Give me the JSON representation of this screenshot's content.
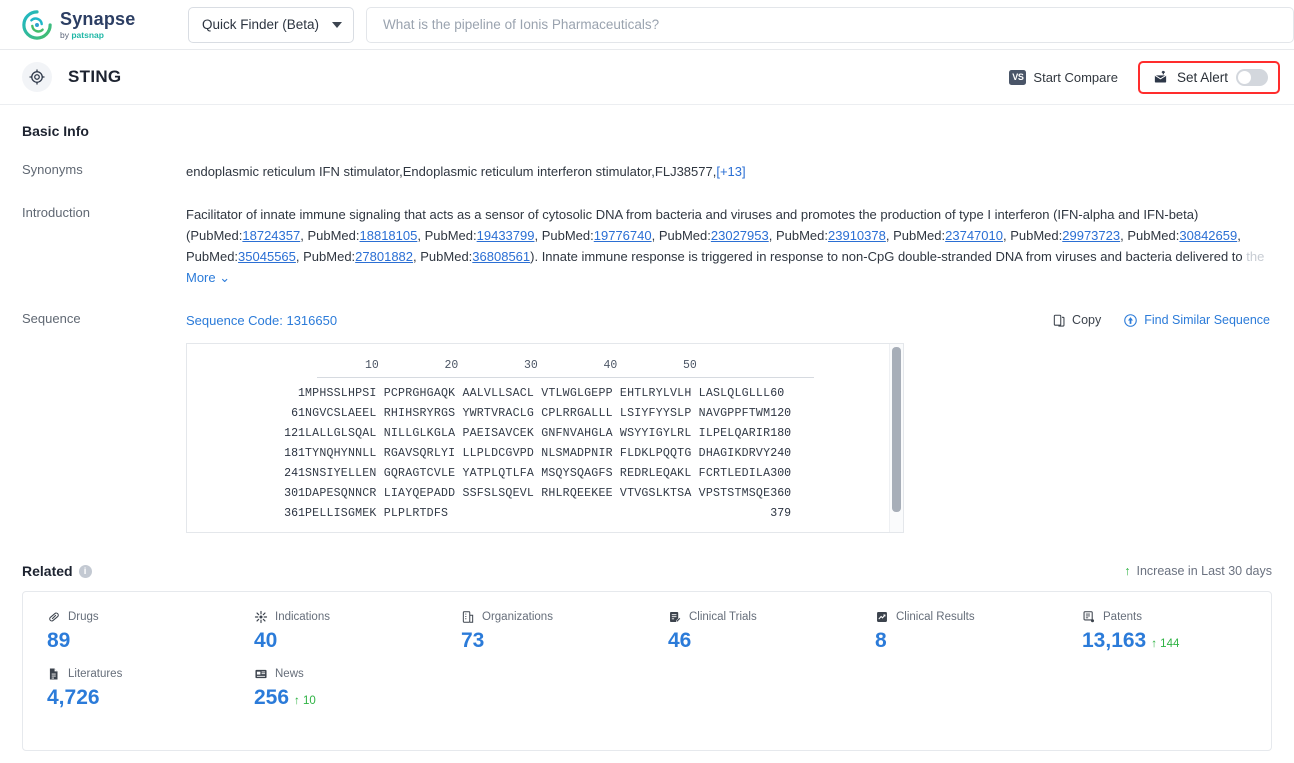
{
  "brand": {
    "name": "Synapse",
    "by": "by ",
    "by_brand": "patsnap"
  },
  "topbar": {
    "finder_label": "Quick Finder (Beta)",
    "search_placeholder": "What is the pipeline of Ionis Pharmaceuticals?",
    "search_value": ""
  },
  "title": {
    "entity": "STING",
    "start_compare": "Start Compare",
    "vs_badge": "VS",
    "set_alert": "Set Alert",
    "alert_toggle_state": "off",
    "highlight_color": "#ff2d2d"
  },
  "basic_info": {
    "heading": "Basic Info",
    "synonyms_label": "Synonyms",
    "synonyms_value": "endoplasmic reticulum IFN stimulator,Endoplasmic reticulum interferon stimulator,FLJ38577,",
    "synonyms_more": "[+13]",
    "introduction_label": "Introduction",
    "introduction_line1": "Facilitator of innate immune signaling that acts as a sensor of cytosolic DNA from bacteria and viruses and promotes the production of type I interferon (IFN-alpha and IFN-beta)",
    "pubmed_prefix": "PubMed:",
    "pubmed_ids": [
      "18724357",
      "18818105",
      "19433799",
      "19776740",
      "23027953",
      "23910378",
      "23747010",
      "29973723",
      "30842659",
      "35045565",
      "27801882",
      "36808561"
    ],
    "introduction_tail": "). Innate immune response is triggered in response to non-CpG double-stranded DNA from viruses and bacteria delivered to",
    "introduction_faded": "the",
    "more_label": "More"
  },
  "sequence": {
    "label": "Sequence",
    "code_label": "Sequence Code: 1316650",
    "copy_label": "Copy",
    "find_similar_label": "Find Similar Sequence",
    "ruler_ticks": [
      "10",
      "20",
      "30",
      "40",
      "50"
    ],
    "rows": [
      {
        "start": "1",
        "residues": "MPHSSLHPSI PCPRGHGAQK AALVLLSACL VTLWGLGEPP EHTLRYLVLH LASLQLGLLL",
        "end": "60"
      },
      {
        "start": "61",
        "residues": "NGVCSLAEEL RHIHSRYRGS YWRTVRACLG CPLRRGALLL LSIYFYYSLP NAVGPPFTWM",
        "end": "120"
      },
      {
        "start": "121",
        "residues": "LALLGLSQAL NILLGLKGLA PAEISAVCEK GNFNVAHGLA WSYYIGYLRL ILPELQARIR",
        "end": "180"
      },
      {
        "start": "181",
        "residues": "TYNQHYNNLL RGAVSQRLYI LLPLDCGVPD NLSMADPNIR FLDKLPQQTG DHAGIKDRVY",
        "end": "240"
      },
      {
        "start": "241",
        "residues": "SNSIYELLEN GQRAGTCVLE YATPLQTLFA MSQYSQAGFS REDRLEQAKL FCRTLEDILA",
        "end": "300"
      },
      {
        "start": "301",
        "residues": "DAPESQNNCR LIAYQEPADD SSFSLSQEVL RHLRQEEKEE VTVGSLKTSA VPSTSTMSQE",
        "end": "360"
      },
      {
        "start": "361",
        "residues": "PELLISGMEK PLPLRTDFS",
        "end": "379"
      }
    ]
  },
  "related": {
    "heading": "Related",
    "increase_note": "Increase in Last 30 days",
    "increase_arrow": "↑",
    "cards": [
      {
        "icon": "pill-icon",
        "label": "Drugs",
        "value": "89",
        "delta": ""
      },
      {
        "icon": "indication-icon",
        "label": "Indications",
        "value": "40",
        "delta": ""
      },
      {
        "icon": "organization-icon",
        "label": "Organizations",
        "value": "73",
        "delta": ""
      },
      {
        "icon": "clinical-trial-icon",
        "label": "Clinical Trials",
        "value": "46",
        "delta": ""
      },
      {
        "icon": "clinical-result-icon",
        "label": "Clinical Results",
        "value": "8",
        "delta": ""
      },
      {
        "icon": "patent-icon",
        "label": "Patents",
        "value": "13,163",
        "delta": "144"
      },
      {
        "icon": "literature-icon",
        "label": "Literatures",
        "value": "4,726",
        "delta": ""
      },
      {
        "icon": "news-icon",
        "label": "News",
        "value": "256",
        "delta": "10"
      }
    ]
  },
  "colors": {
    "accent_blue": "#2b7bd9",
    "link_blue": "#2b6fd4",
    "green": "#2fb344",
    "alert_red": "#ff2d2d"
  }
}
